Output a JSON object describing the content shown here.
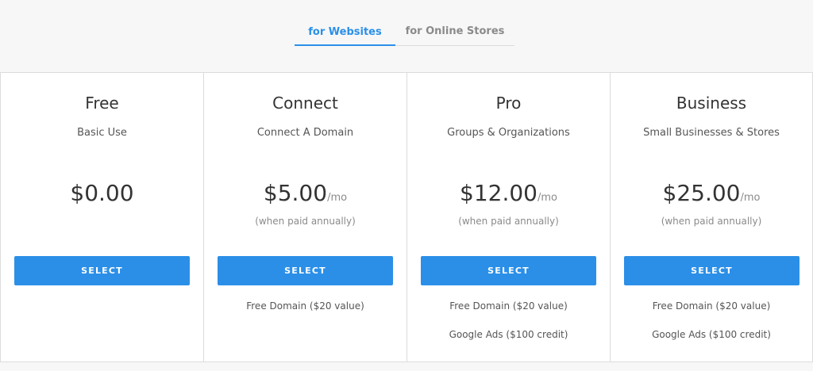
{
  "tabs": [
    {
      "label": "for Websites",
      "active": true
    },
    {
      "label": "for Online Stores",
      "active": false
    }
  ],
  "colors": {
    "accent": "#2b8fe8",
    "border": "#dcdcdc",
    "background": "#f7f7f7"
  },
  "plans": [
    {
      "name": "Free",
      "subtitle": "Basic Use",
      "price": "$0.00",
      "unit": "",
      "note": "",
      "button": "SELECT",
      "features": []
    },
    {
      "name": "Connect",
      "subtitle": "Connect A Domain",
      "price": "$5.00",
      "unit": "/mo",
      "note": "(when paid annually)",
      "button": "SELECT",
      "features": [
        "Free Domain ($20 value)"
      ]
    },
    {
      "name": "Pro",
      "subtitle": "Groups & Organizations",
      "price": "$12.00",
      "unit": "/mo",
      "note": "(when paid annually)",
      "button": "SELECT",
      "features": [
        "Free Domain ($20 value)",
        "Google Ads ($100 credit)"
      ]
    },
    {
      "name": "Business",
      "subtitle": "Small Businesses & Stores",
      "price": "$25.00",
      "unit": "/mo",
      "note": "(when paid annually)",
      "button": "SELECT",
      "features": [
        "Free Domain ($20 value)",
        "Google Ads ($100 credit)"
      ]
    }
  ]
}
